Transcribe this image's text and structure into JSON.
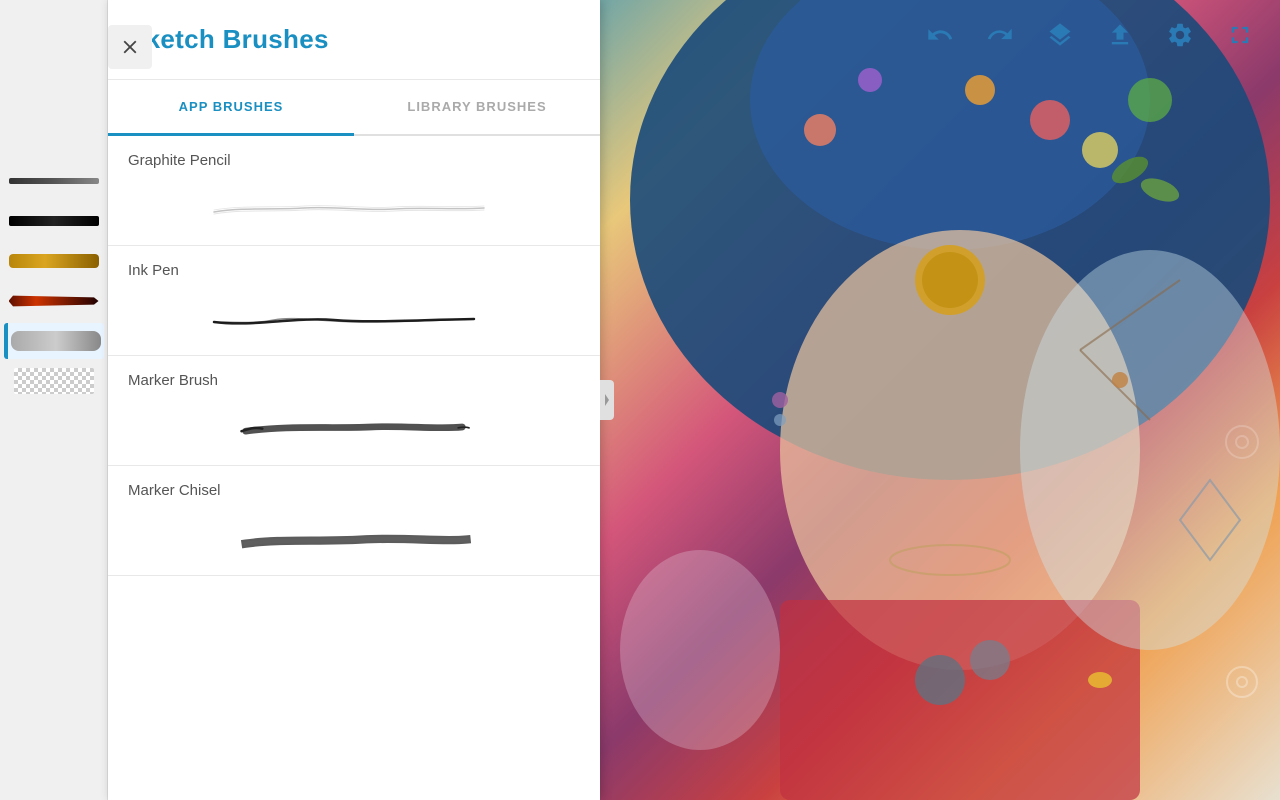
{
  "app": {
    "title": "Sketch Brushes"
  },
  "panel": {
    "title": "Sketch Brushes",
    "tabs": [
      {
        "id": "app-brushes",
        "label": "APP BRUSHES",
        "active": true
      },
      {
        "id": "library-brushes",
        "label": "LIBRARY BRUSHES",
        "active": false
      }
    ],
    "brushes": [
      {
        "id": "graphite-pencil",
        "name": "Graphite Pencil",
        "stroke_type": "thin_wavy"
      },
      {
        "id": "ink-pen",
        "name": "Ink Pen",
        "stroke_type": "medium_smooth"
      },
      {
        "id": "marker-brush",
        "name": "Marker Brush",
        "stroke_type": "thick_tapered"
      },
      {
        "id": "marker-chisel",
        "name": "Marker Chisel",
        "stroke_type": "chisel_stroke"
      }
    ]
  },
  "toolbar": {
    "buttons": [
      {
        "id": "undo",
        "icon": "undo-icon",
        "label": "Undo"
      },
      {
        "id": "redo",
        "icon": "redo-icon",
        "label": "Redo"
      },
      {
        "id": "layers",
        "icon": "layers-icon",
        "label": "Layers"
      },
      {
        "id": "share",
        "icon": "share-icon",
        "label": "Share"
      },
      {
        "id": "settings",
        "icon": "settings-icon",
        "label": "Settings"
      },
      {
        "id": "fullscreen",
        "icon": "fullscreen-icon",
        "label": "Fullscreen"
      }
    ]
  },
  "left_toolbar": {
    "brushes": [
      {
        "id": "brush-1",
        "type": "dark"
      },
      {
        "id": "brush-2",
        "type": "black"
      },
      {
        "id": "brush-3",
        "type": "yellow"
      },
      {
        "id": "brush-4",
        "type": "orange"
      },
      {
        "id": "brush-5",
        "type": "gray",
        "selected": true
      },
      {
        "id": "brush-6",
        "type": "checker"
      }
    ]
  },
  "colors": {
    "accent": "#1a8fc1",
    "text_primary": "#555555",
    "background": "#ffffff",
    "border": "#e0e0e0"
  },
  "icons": {
    "close": "✕",
    "chevron_left": "‹"
  }
}
